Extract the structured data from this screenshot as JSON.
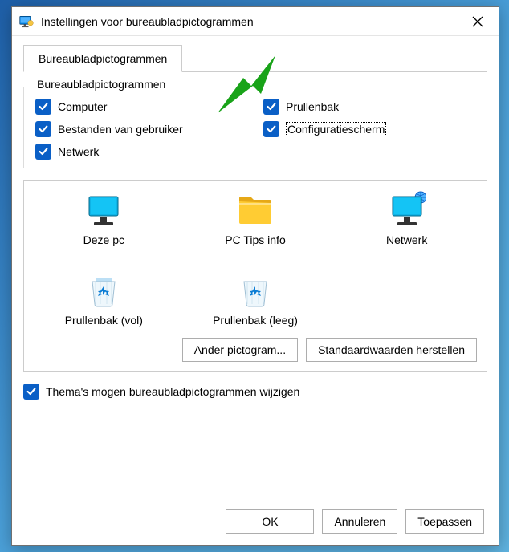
{
  "window": {
    "title": "Instellingen voor bureaubladpictogrammen"
  },
  "tab": {
    "label": "Bureaubladpictogrammen"
  },
  "group": {
    "title": "Bureaubladpictogrammen",
    "items": [
      {
        "label": "Computer",
        "checked": true
      },
      {
        "label": "Prullenbak",
        "checked": true
      },
      {
        "label": "Bestanden van gebruiker",
        "checked": true
      },
      {
        "label": "Configuratiescherm",
        "checked": true,
        "focused": true
      },
      {
        "label": "Netwerk",
        "checked": true
      }
    ]
  },
  "icons": {
    "items": [
      {
        "name": "this-pc",
        "label": "Deze pc"
      },
      {
        "name": "user-folder",
        "label": "PC Tips info"
      },
      {
        "name": "network",
        "label": "Netwerk"
      },
      {
        "name": "recycle-full",
        "label": "Prullenbak (vol)"
      },
      {
        "name": "recycle-empty",
        "label": "Prullenbak (leeg)"
      }
    ],
    "change_button": "Ander pictogram...",
    "restore_button": "Standaardwaarden herstellen"
  },
  "theme_check": {
    "label": "Thema's mogen bureaubladpictogrammen wijzigen",
    "checked": true
  },
  "buttons": {
    "ok": "OK",
    "cancel": "Annuleren",
    "apply": "Toepassen"
  }
}
